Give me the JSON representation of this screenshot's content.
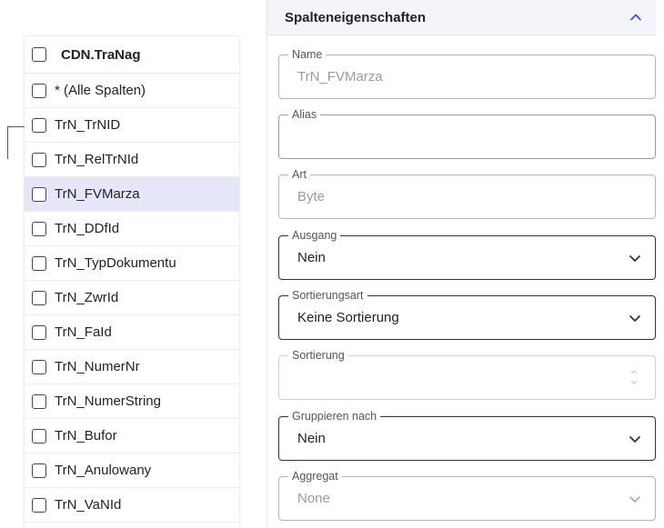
{
  "table": {
    "name": "CDN.TraNag",
    "rows": [
      {
        "label": "* (Alle Spalten)"
      },
      {
        "label": "TrN_TrNID"
      },
      {
        "label": "TrN_RelTrNId"
      },
      {
        "label": "TrN_FVMarza",
        "selected": true
      },
      {
        "label": "TrN_DDfId"
      },
      {
        "label": "TrN_TypDokumentu"
      },
      {
        "label": "TrN_ZwrId"
      },
      {
        "label": "TrN_FaId"
      },
      {
        "label": "TrN_NumerNr"
      },
      {
        "label": "TrN_NumerString"
      },
      {
        "label": "TrN_Bufor"
      },
      {
        "label": "TrN_Anulowany"
      },
      {
        "label": "TrN_VaNId"
      }
    ]
  },
  "panel": {
    "title": "Spalteneigenschaften",
    "fields": {
      "name": {
        "label": "Name",
        "value": "TrN_FVMarza"
      },
      "alias": {
        "label": "Alias",
        "value": ""
      },
      "art": {
        "label": "Art",
        "value": "Byte"
      },
      "ausgang": {
        "label": "Ausgang",
        "value": "Nein"
      },
      "sortierungsart": {
        "label": "Sortierungsart",
        "value": "Keine Sortierung"
      },
      "sortierung": {
        "label": "Sortierung",
        "value": ""
      },
      "gruppieren": {
        "label": "Gruppieren nach",
        "value": "Nein"
      },
      "aggregat": {
        "label": "Aggregat",
        "value": "None"
      }
    }
  },
  "colors": {
    "selected_row": "#e6e6fa",
    "panel_header": "#f4f4fb",
    "border_active": "#333333",
    "border_disabled": "#b5b5b5"
  }
}
